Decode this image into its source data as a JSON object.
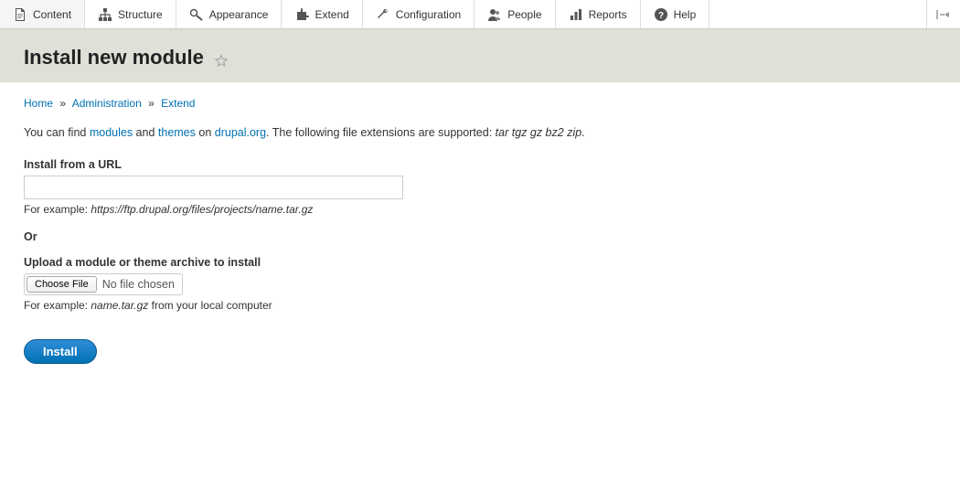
{
  "toolbar": {
    "items": [
      {
        "label": "Content"
      },
      {
        "label": "Structure"
      },
      {
        "label": "Appearance"
      },
      {
        "label": "Extend"
      },
      {
        "label": "Configuration"
      },
      {
        "label": "People"
      },
      {
        "label": "Reports"
      },
      {
        "label": "Help"
      }
    ]
  },
  "page": {
    "title": "Install new module"
  },
  "breadcrumb": {
    "home": "Home",
    "admin": "Administration",
    "extend": "Extend",
    "sep": "»"
  },
  "intro": {
    "part1": "You can find ",
    "modules": "modules",
    "part2": " and ",
    "themes": "themes",
    "part3": " on ",
    "drupal": "drupal.org",
    "part4": ". The following file extensions are supported: ",
    "ext": "tar tgz gz bz2 zip",
    "part5": "."
  },
  "url_field": {
    "label": "Install from a URL",
    "help_prefix": "For example: ",
    "help_example": "https://ftp.drupal.org/files/projects/name.tar.gz"
  },
  "or": "Or",
  "upload_field": {
    "label": "Upload a module or theme archive to install",
    "button": "Choose File",
    "status": "No file chosen",
    "help_prefix": "For example: ",
    "help_example": "name.tar.gz",
    "help_suffix": " from your local computer"
  },
  "submit": "Install"
}
